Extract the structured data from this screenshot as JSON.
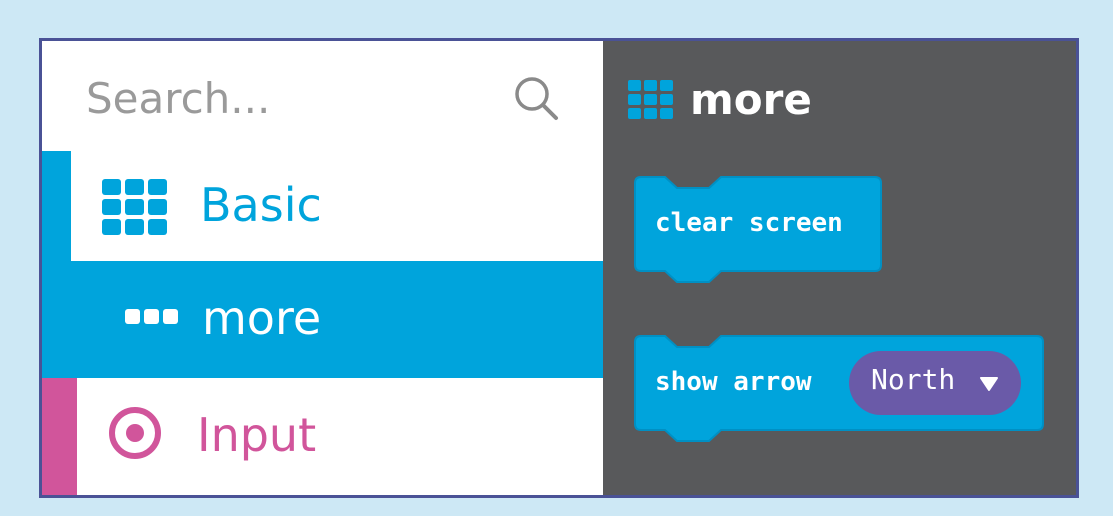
{
  "search": {
    "placeholder": "Search..."
  },
  "categories": [
    {
      "label": "Basic",
      "icon": "grid-icon",
      "color": "#00a4dc"
    },
    {
      "label": "more",
      "icon": "dots-icon",
      "color": "#00a4dc",
      "selected": true
    },
    {
      "label": "Input",
      "icon": "target-icon",
      "color": "#d1559b"
    }
  ],
  "flyout": {
    "title": "more",
    "title_icon": "grid-icon",
    "blocks": [
      {
        "text": "clear screen",
        "color": "#00a4dc"
      },
      {
        "text": "show arrow",
        "color": "#00a4dc",
        "dropdown": {
          "value": "North",
          "color": "#6a5aa8"
        }
      }
    ]
  },
  "colors": {
    "workspace": "#58595b",
    "border": "#4a5296",
    "page": "#cde8f5"
  }
}
